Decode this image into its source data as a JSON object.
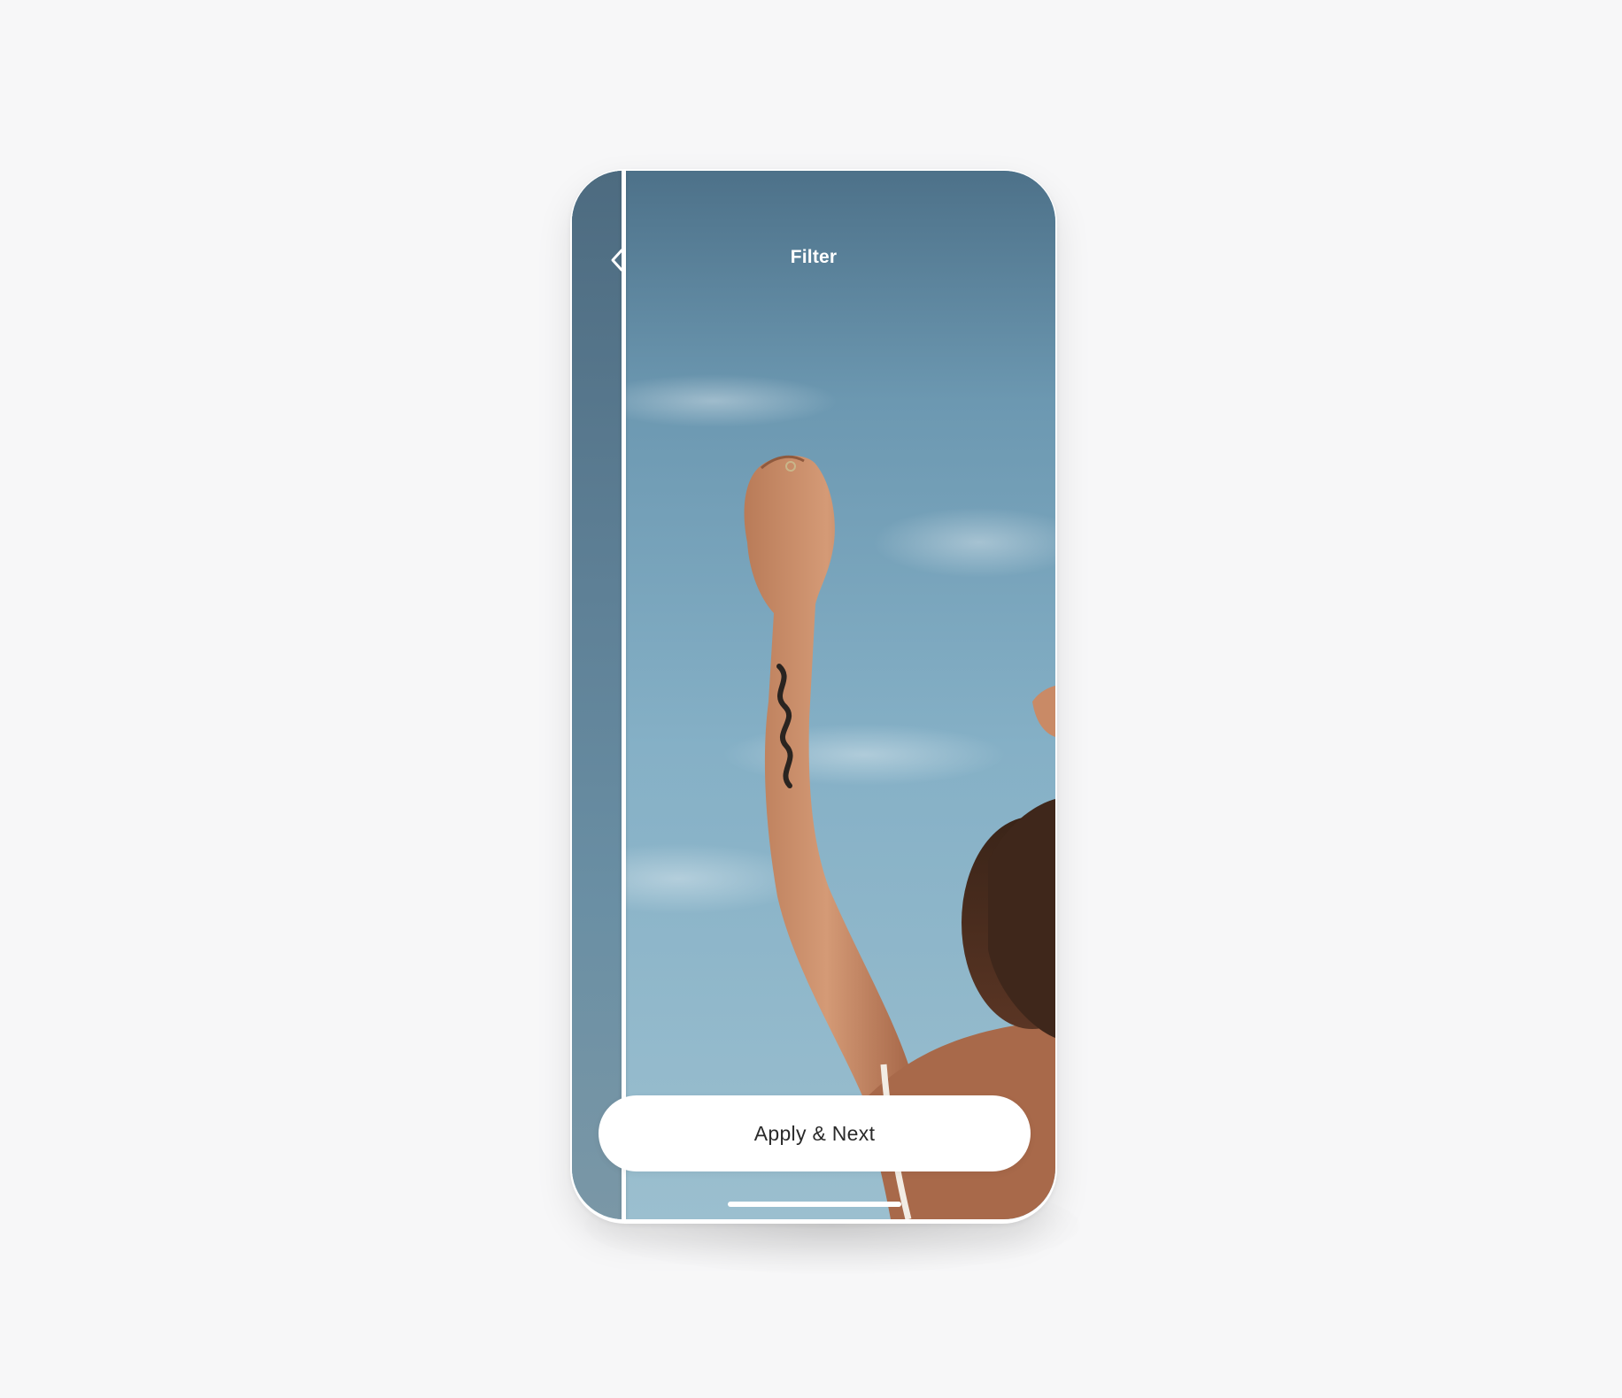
{
  "header": {
    "title": "Filter",
    "back_icon": "chevron-left-icon"
  },
  "photo": {
    "subject": "raised-arm-with-snake-tattoo",
    "sky_colors": [
      "#4d7189",
      "#7aa7be",
      "#9bbfcf"
    ]
  },
  "compare": {
    "divider_color": "#ffffff"
  },
  "actions": {
    "apply_label": "Apply & Next"
  },
  "colors": {
    "page_background": "#f7f7f8",
    "button_background": "#ffffff",
    "button_text": "#2a2a2a"
  }
}
